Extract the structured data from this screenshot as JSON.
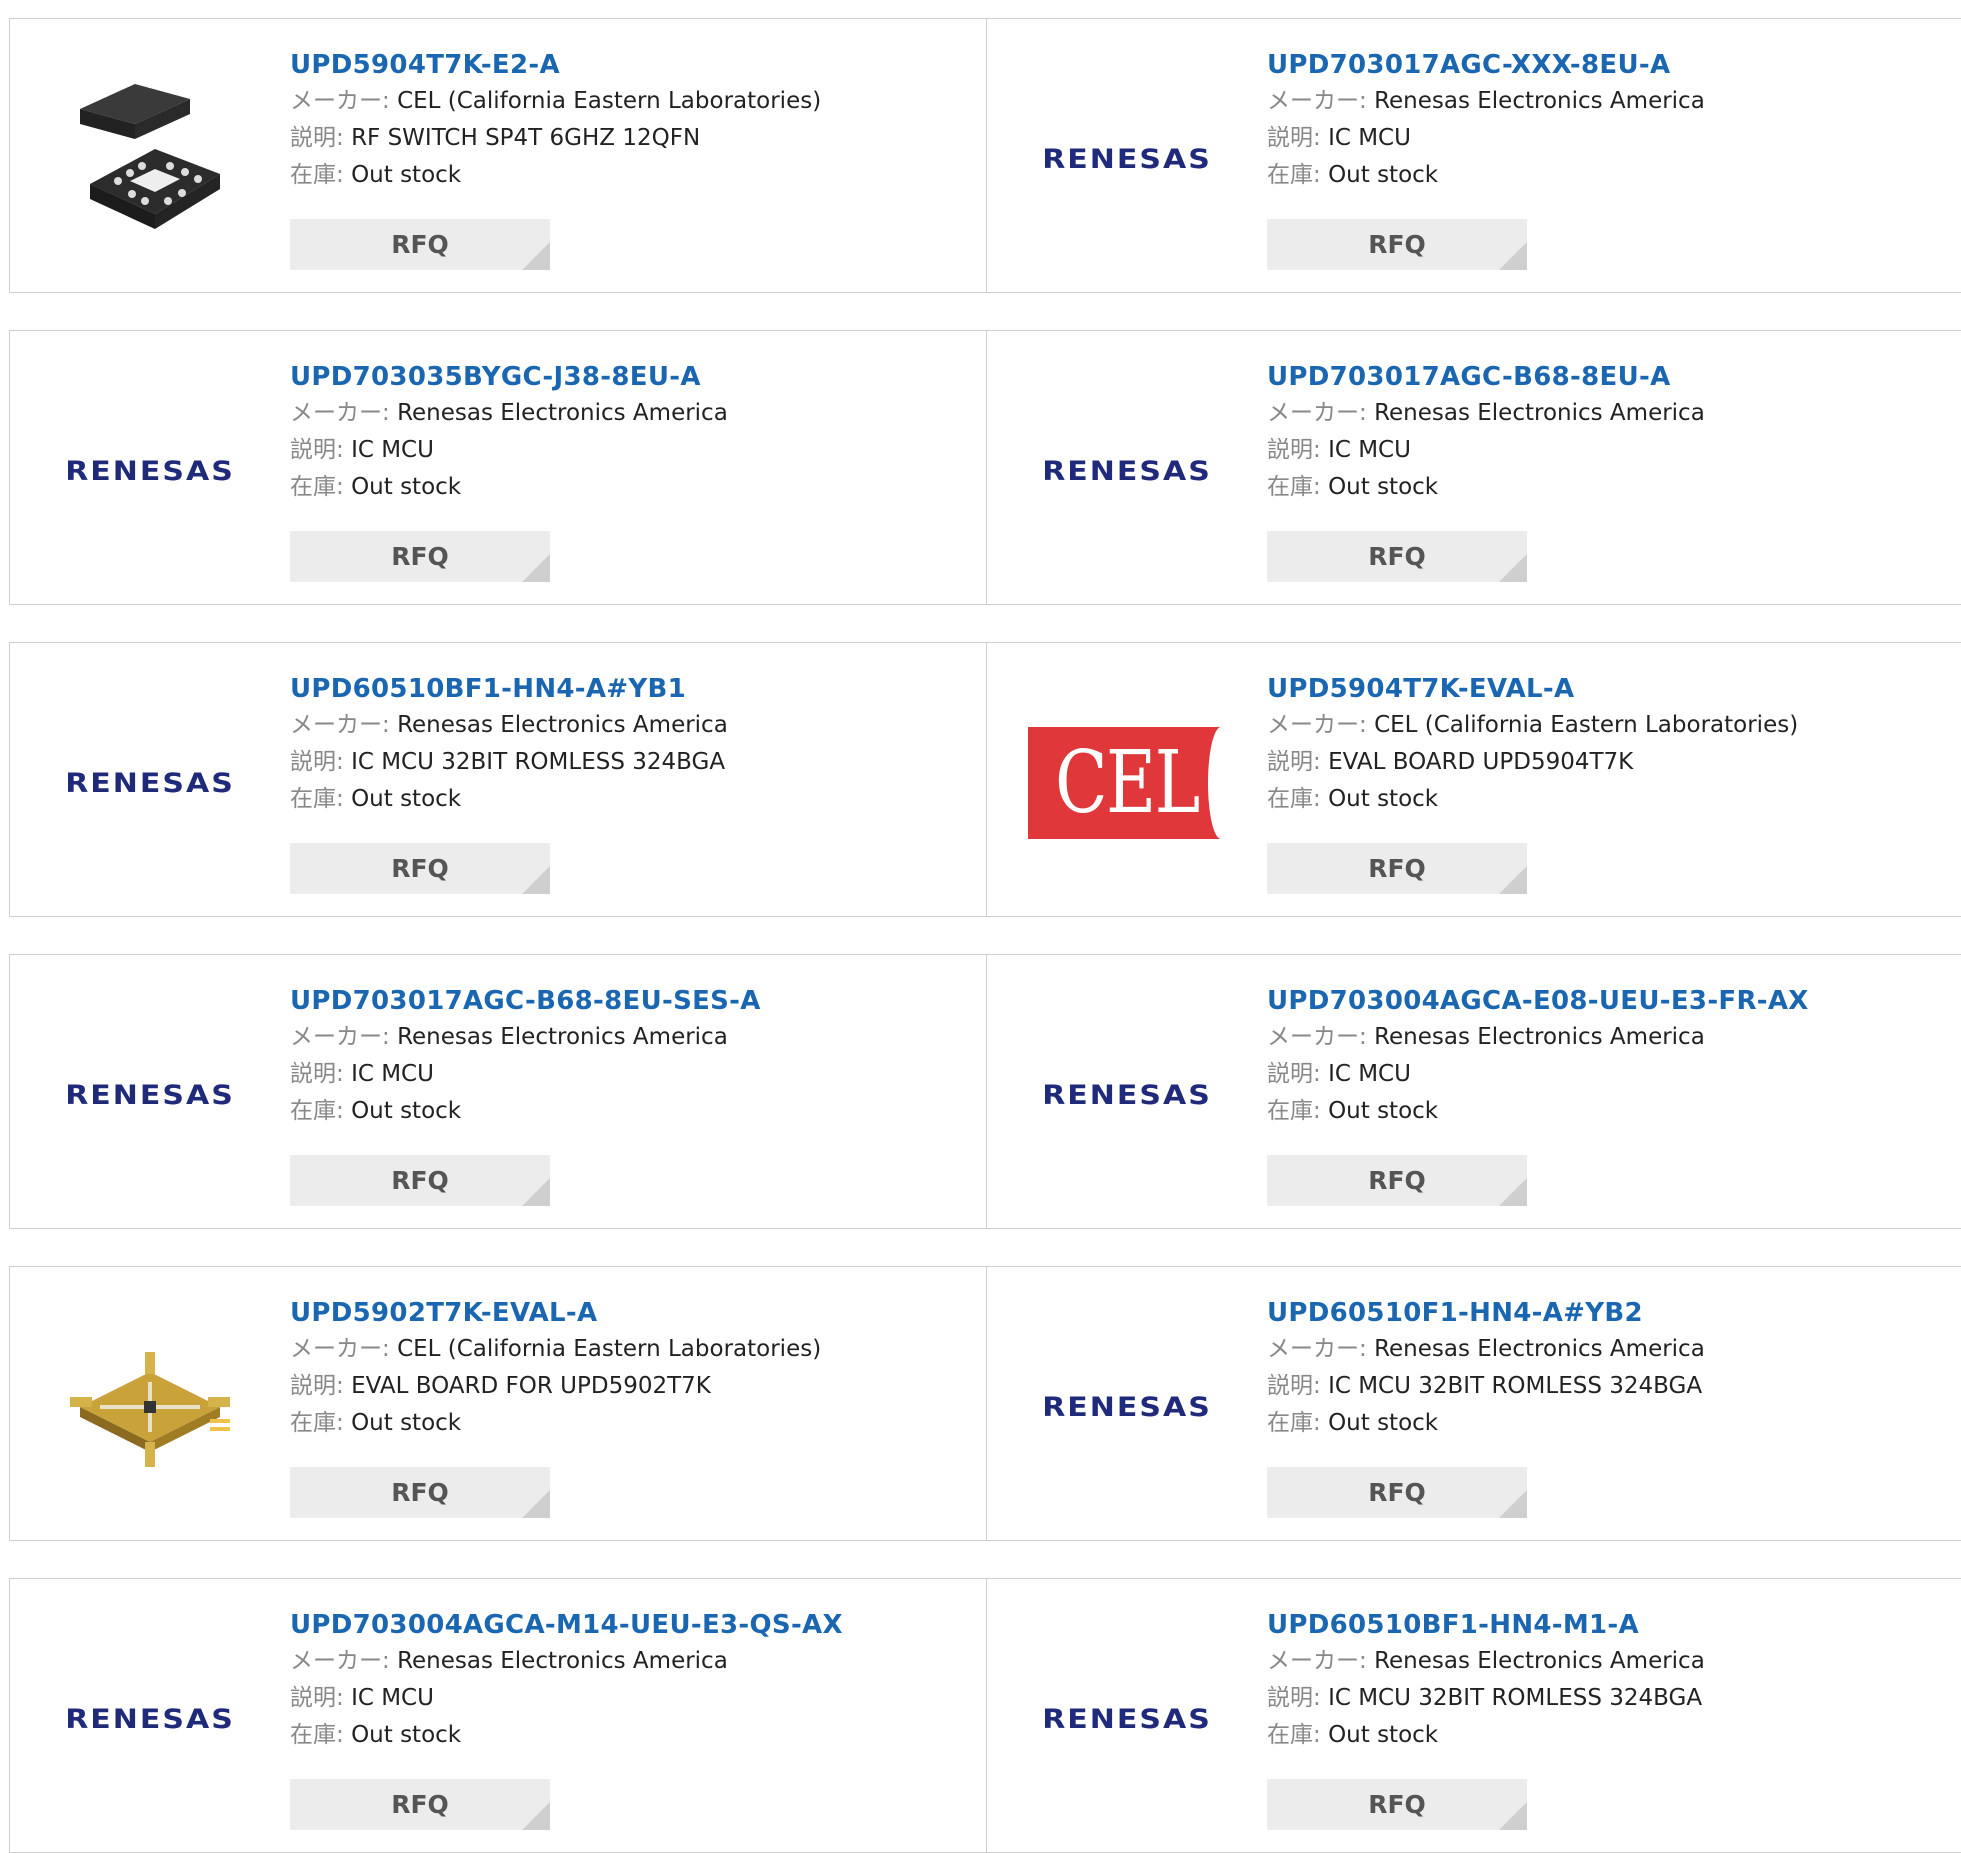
{
  "labels": {
    "maker": "メーカー:",
    "desc": "説明:",
    "stock": "在庫:"
  },
  "rfq_label": "RFQ",
  "brand_text": {
    "renesas": "RENESAS",
    "cel": "CEL"
  },
  "products": [
    {
      "pn": "UPD5904T7K-E2-A",
      "maker": "CEL (California Eastern Laboratories)",
      "desc": "RF SWITCH SP4T 6GHZ 12QFN",
      "stock": "Out stock",
      "image": "qfn-chip-icon"
    },
    {
      "pn": "UPD703017AGC-XXX-8EU-A",
      "maker": "Renesas Electronics America",
      "desc": "IC MCU",
      "stock": "Out stock",
      "image": "renesas-logo"
    },
    {
      "pn": "UPD703035BYGC-J38-8EU-A",
      "maker": "Renesas Electronics America",
      "desc": "IC MCU",
      "stock": "Out stock",
      "image": "renesas-logo"
    },
    {
      "pn": "UPD703017AGC-B68-8EU-A",
      "maker": "Renesas Electronics America",
      "desc": "IC MCU",
      "stock": "Out stock",
      "image": "renesas-logo"
    },
    {
      "pn": "UPD60510BF1-HN4-A#YB1",
      "maker": "Renesas Electronics America",
      "desc": "IC MCU 32BIT ROMLESS 324BGA",
      "stock": "Out stock",
      "image": "renesas-logo"
    },
    {
      "pn": "UPD5904T7K-EVAL-A",
      "maker": "CEL (California Eastern Laboratories)",
      "desc": "EVAL BOARD UPD5904T7K",
      "stock": "Out stock",
      "image": "cel-logo"
    },
    {
      "pn": "UPD703017AGC-B68-8EU-SES-A",
      "maker": "Renesas Electronics America",
      "desc": "IC MCU",
      "stock": "Out stock",
      "image": "renesas-logo"
    },
    {
      "pn": "UPD703004AGCA-E08-UEU-E3-FR-AX",
      "maker": "Renesas Electronics America",
      "desc": "IC MCU",
      "stock": "Out stock",
      "image": "renesas-logo"
    },
    {
      "pn": "UPD5902T7K-EVAL-A",
      "maker": "CEL (California Eastern Laboratories)",
      "desc": "EVAL BOARD FOR UPD5902T7K",
      "stock": "Out stock",
      "image": "eval-board-icon"
    },
    {
      "pn": "UPD60510F1-HN4-A#YB2",
      "maker": "Renesas Electronics America",
      "desc": "IC MCU 32BIT ROMLESS 324BGA",
      "stock": "Out stock",
      "image": "renesas-logo"
    },
    {
      "pn": "UPD703004AGCA-M14-UEU-E3-QS-AX",
      "maker": "Renesas Electronics America",
      "desc": "IC MCU",
      "stock": "Out stock",
      "image": "renesas-logo"
    },
    {
      "pn": "UPD60510BF1-HN4-M1-A",
      "maker": "Renesas Electronics America",
      "desc": "IC MCU 32BIT ROMLESS 324BGA",
      "stock": "Out stock",
      "image": "renesas-logo"
    }
  ]
}
